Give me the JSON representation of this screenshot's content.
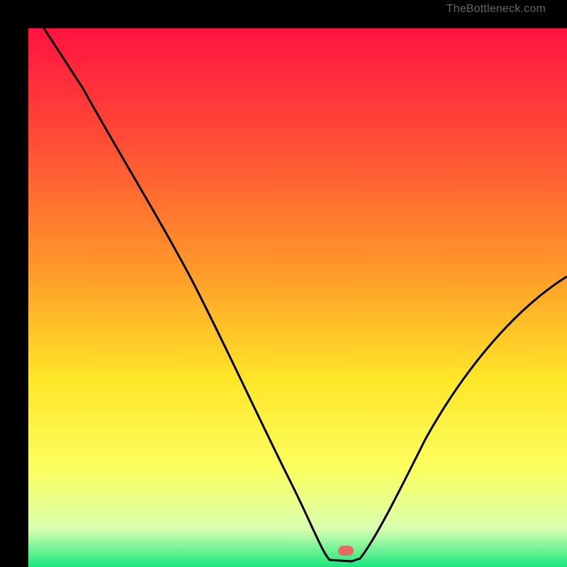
{
  "watermark": "TheBottleneck.com",
  "chart_data": {
    "type": "line",
    "title": "",
    "xlabel": "",
    "ylabel": "",
    "xlim": [
      0,
      100
    ],
    "ylim": [
      0,
      100
    ],
    "x": [
      3,
      10,
      20,
      25,
      30,
      35,
      40,
      45,
      50,
      53,
      55,
      57,
      58.5,
      60,
      61.5,
      65,
      70,
      75,
      80,
      85,
      90,
      95,
      100
    ],
    "values": [
      100,
      89,
      73,
      65,
      57,
      49,
      41,
      33,
      22,
      13,
      7,
      3,
      1,
      0.5,
      0.4,
      2,
      7,
      14,
      22,
      30,
      38,
      46,
      54
    ],
    "flat_floor": {
      "x_start": 55,
      "x_end": 60,
      "y": 0.5
    },
    "marker": {
      "x": 59,
      "y": 0.5,
      "color": "#e36b63"
    },
    "background_gradient_stops": [
      {
        "pos": 0.0,
        "color": "#ff133f"
      },
      {
        "pos": 0.2,
        "color": "#ff4a36"
      },
      {
        "pos": 0.45,
        "color": "#ff9a29"
      },
      {
        "pos": 0.65,
        "color": "#ffe628"
      },
      {
        "pos": 0.82,
        "color": "#fbff60"
      },
      {
        "pos": 0.93,
        "color": "#d8ffb0"
      },
      {
        "pos": 1.0,
        "color": "#18e67e"
      }
    ]
  }
}
